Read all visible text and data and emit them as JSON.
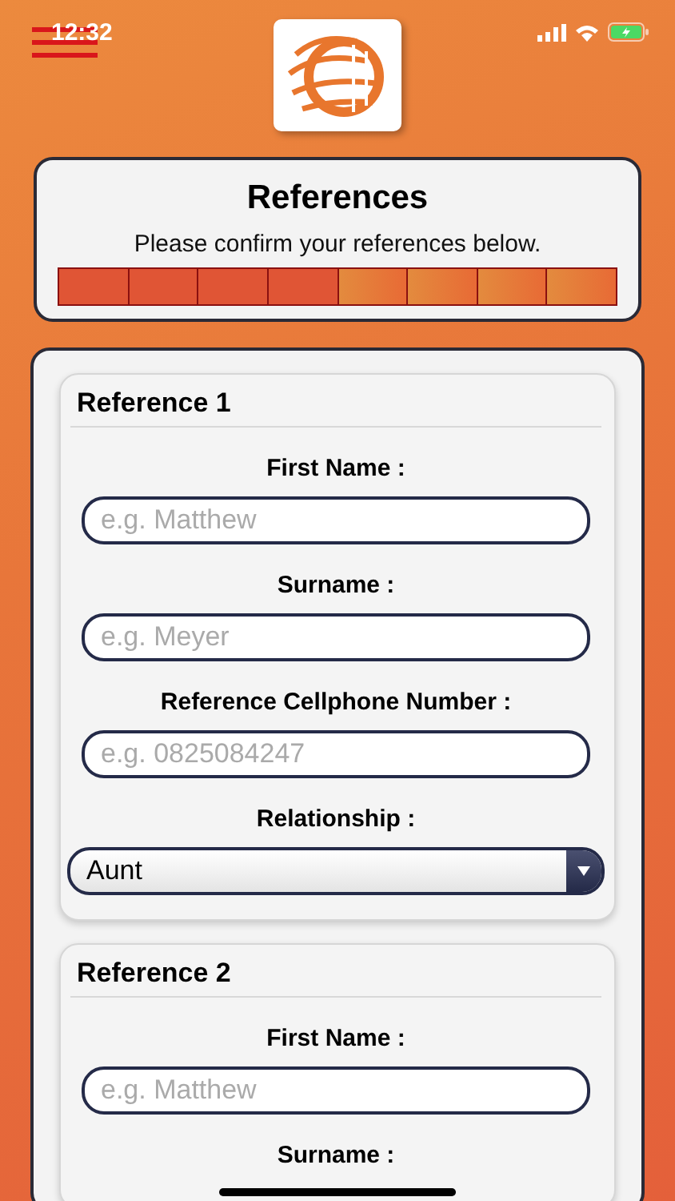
{
  "status_bar": {
    "time": "12:32"
  },
  "header": {
    "title": "References",
    "subtitle": "Please confirm your references below.",
    "progress": [
      {
        "done": true
      },
      {
        "done": true
      },
      {
        "done": true
      },
      {
        "done": true
      },
      {
        "done": false
      },
      {
        "done": false
      },
      {
        "done": false
      },
      {
        "done": false
      }
    ]
  },
  "references": [
    {
      "title": "Reference 1",
      "fields": [
        {
          "kind": "text",
          "label": "First Name :",
          "placeholder": "e.g. Matthew"
        },
        {
          "kind": "text",
          "label": "Surname :",
          "placeholder": "e.g. Meyer"
        },
        {
          "kind": "text",
          "label": "Reference Cellphone Number :",
          "placeholder": "e.g. 0825084247"
        },
        {
          "kind": "select",
          "label": "Relationship :",
          "value": "Aunt"
        }
      ]
    },
    {
      "title": "Reference 2",
      "fields": [
        {
          "kind": "text",
          "label": "First Name :",
          "placeholder": "e.g. Matthew"
        },
        {
          "kind": "label",
          "label": "Surname :"
        }
      ]
    }
  ]
}
